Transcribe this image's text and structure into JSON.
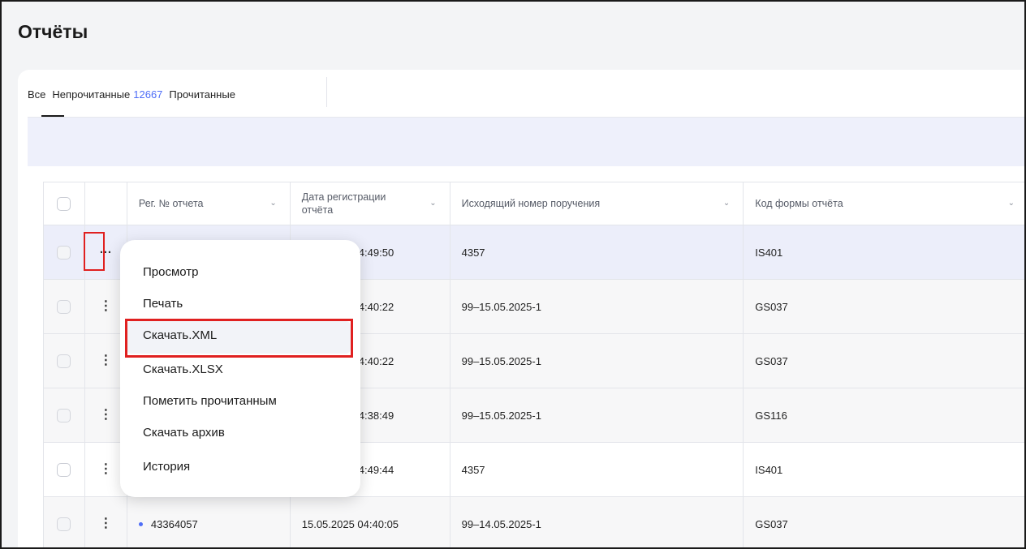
{
  "page": {
    "title": "Отчёты"
  },
  "tabs": {
    "all": "Все",
    "unread": "Непрочитанные",
    "unread_count": "12667",
    "read": "Прочитанные"
  },
  "table": {
    "headers": {
      "reg_no": "Рег. № отчета",
      "reg_date": "Дата регистрации отчёта",
      "outgoing_no": "Исходящий номер поручения",
      "form_code": "Код формы отчёта"
    },
    "rows": [
      {
        "reg_no": "",
        "reg_date": "5 04:49:50",
        "outgoing_no": "4357",
        "form_code": "IS401"
      },
      {
        "reg_no": "",
        "reg_date": "5 04:40:22",
        "outgoing_no": "99–15.05.2025-1",
        "form_code": "GS037"
      },
      {
        "reg_no": "",
        "reg_date": "5 04:40:22",
        "outgoing_no": "99–15.05.2025-1",
        "form_code": "GS037"
      },
      {
        "reg_no": "",
        "reg_date": "5 04:38:49",
        "outgoing_no": "99–15.05.2025-1",
        "form_code": "GS116"
      },
      {
        "reg_no": "",
        "reg_date": "5 04:49:44",
        "outgoing_no": "4357",
        "form_code": "IS401"
      },
      {
        "reg_no": "43364057",
        "reg_date": "15.05.2025 04:40:05",
        "outgoing_no": "99–14.05.2025-1",
        "form_code": "GS037"
      }
    ]
  },
  "context_menu": {
    "items": [
      "Просмотр",
      "Печать",
      "Скачать.XML",
      "Скачать.XLSX",
      "Пометить прочитанным",
      "Скачать архив",
      "История"
    ]
  },
  "icons": {
    "row_actions_open": "more-horizontal-icon",
    "row_actions": "more-vertical-icon",
    "sort": "chevron-down-icon"
  },
  "colors": {
    "accent": "#4f6ef7",
    "highlight": "#e02020",
    "active_row": "#eceefa"
  }
}
